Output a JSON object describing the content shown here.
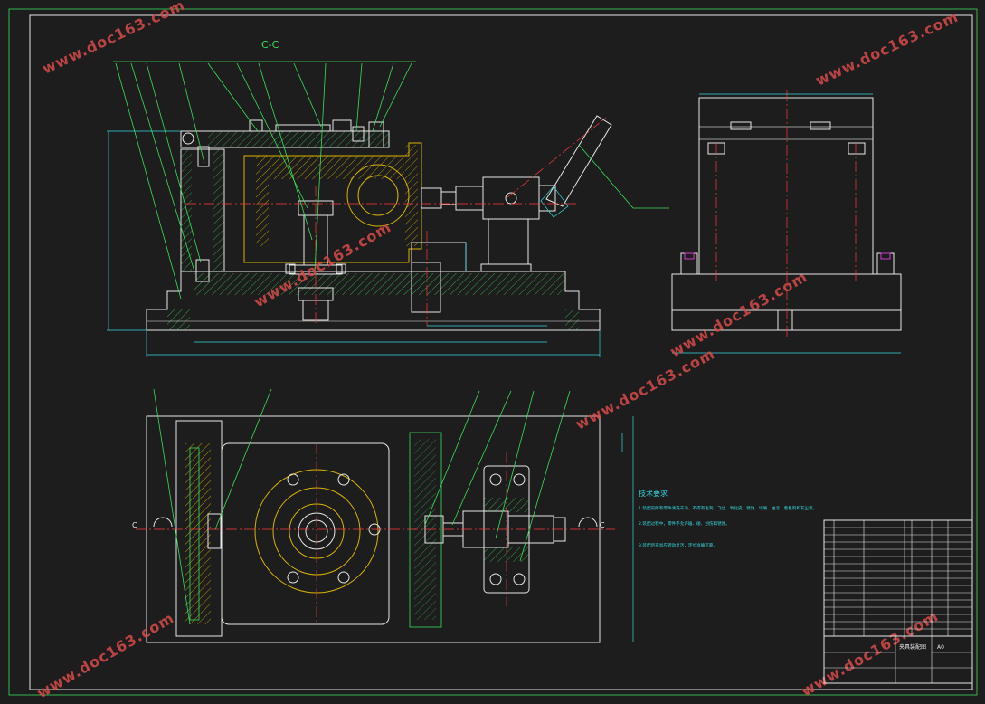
{
  "drawing": {
    "section_label": "C-C",
    "notes_heading": "技术要求",
    "notes": [
      "1.装配前所有零件清洗干净，不得有毛刺、飞边、氧化皮、锈蚀、切屑、油污、着色剂和灰尘等。",
      "2.装配过程中，零件不允许磕、碰、划伤和锈蚀。",
      "3.装配后夹具应转动灵活，定位准确可靠。"
    ],
    "section_marks": [
      "C",
      "C"
    ],
    "title_block": {
      "title": "夹具装配图",
      "drawing_no": "A0"
    }
  },
  "watermarks": [
    "www.doc163.com",
    "www.doc163.com",
    "www.doc163.com",
    "www.doc163.com",
    "www.doc163.com",
    "www.doc163.com",
    "www.doc163.com"
  ],
  "colors": {
    "background": "#1d1d1d",
    "outline": "#e8e8e8",
    "leader": "#3adf5a",
    "hatch": "#d9b400",
    "centerline": "#ff3a3a",
    "dimension": "#37d7e0"
  }
}
